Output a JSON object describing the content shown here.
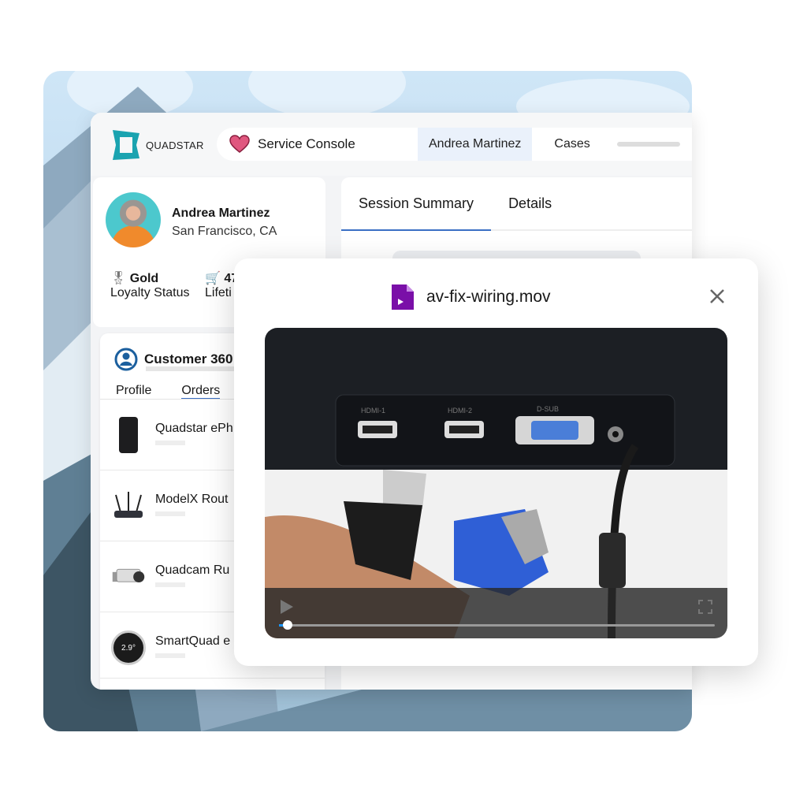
{
  "brand": {
    "logo_text": "QUADSTAR",
    "accent": "#1aa3b0"
  },
  "nav": {
    "app_name": "Service Console",
    "tabs": [
      {
        "label": "Andrea Martinez",
        "active": true
      },
      {
        "label": "Cases",
        "active": false
      }
    ]
  },
  "customer": {
    "name": "Andrea Martinez",
    "location": "San Francisco, CA",
    "stats": [
      {
        "icon": "award-icon",
        "value": "Gold",
        "label": "Loyalty Status"
      },
      {
        "icon": "cart-icon",
        "value": "47",
        "label": "Lifeti"
      }
    ]
  },
  "customer360": {
    "title": "Customer 360",
    "tabs": [
      {
        "label": "Profile",
        "active": false
      },
      {
        "label": "Orders",
        "active": true
      }
    ],
    "orders": [
      {
        "name": "Quadstar ePh",
        "icon": "phone-icon"
      },
      {
        "name": "ModelX Rout",
        "icon": "router-icon"
      },
      {
        "name": "Quadcam Ru",
        "icon": "camera-icon"
      },
      {
        "name": "SmartQuad e",
        "icon": "thermostat-icon",
        "display": "2.9°"
      }
    ]
  },
  "session": {
    "tabs": [
      {
        "label": "Session Summary",
        "active": true
      },
      {
        "label": "Details",
        "active": false
      }
    ]
  },
  "modal": {
    "file_name": "av-fix-wiring.mov",
    "file_icon": "video-file-icon",
    "file_icon_color": "#7a0fa8",
    "video": {
      "progress_percent": 2,
      "labels": [
        "HDMI-1",
        "HDMI-2",
        "D-SUB"
      ]
    }
  }
}
